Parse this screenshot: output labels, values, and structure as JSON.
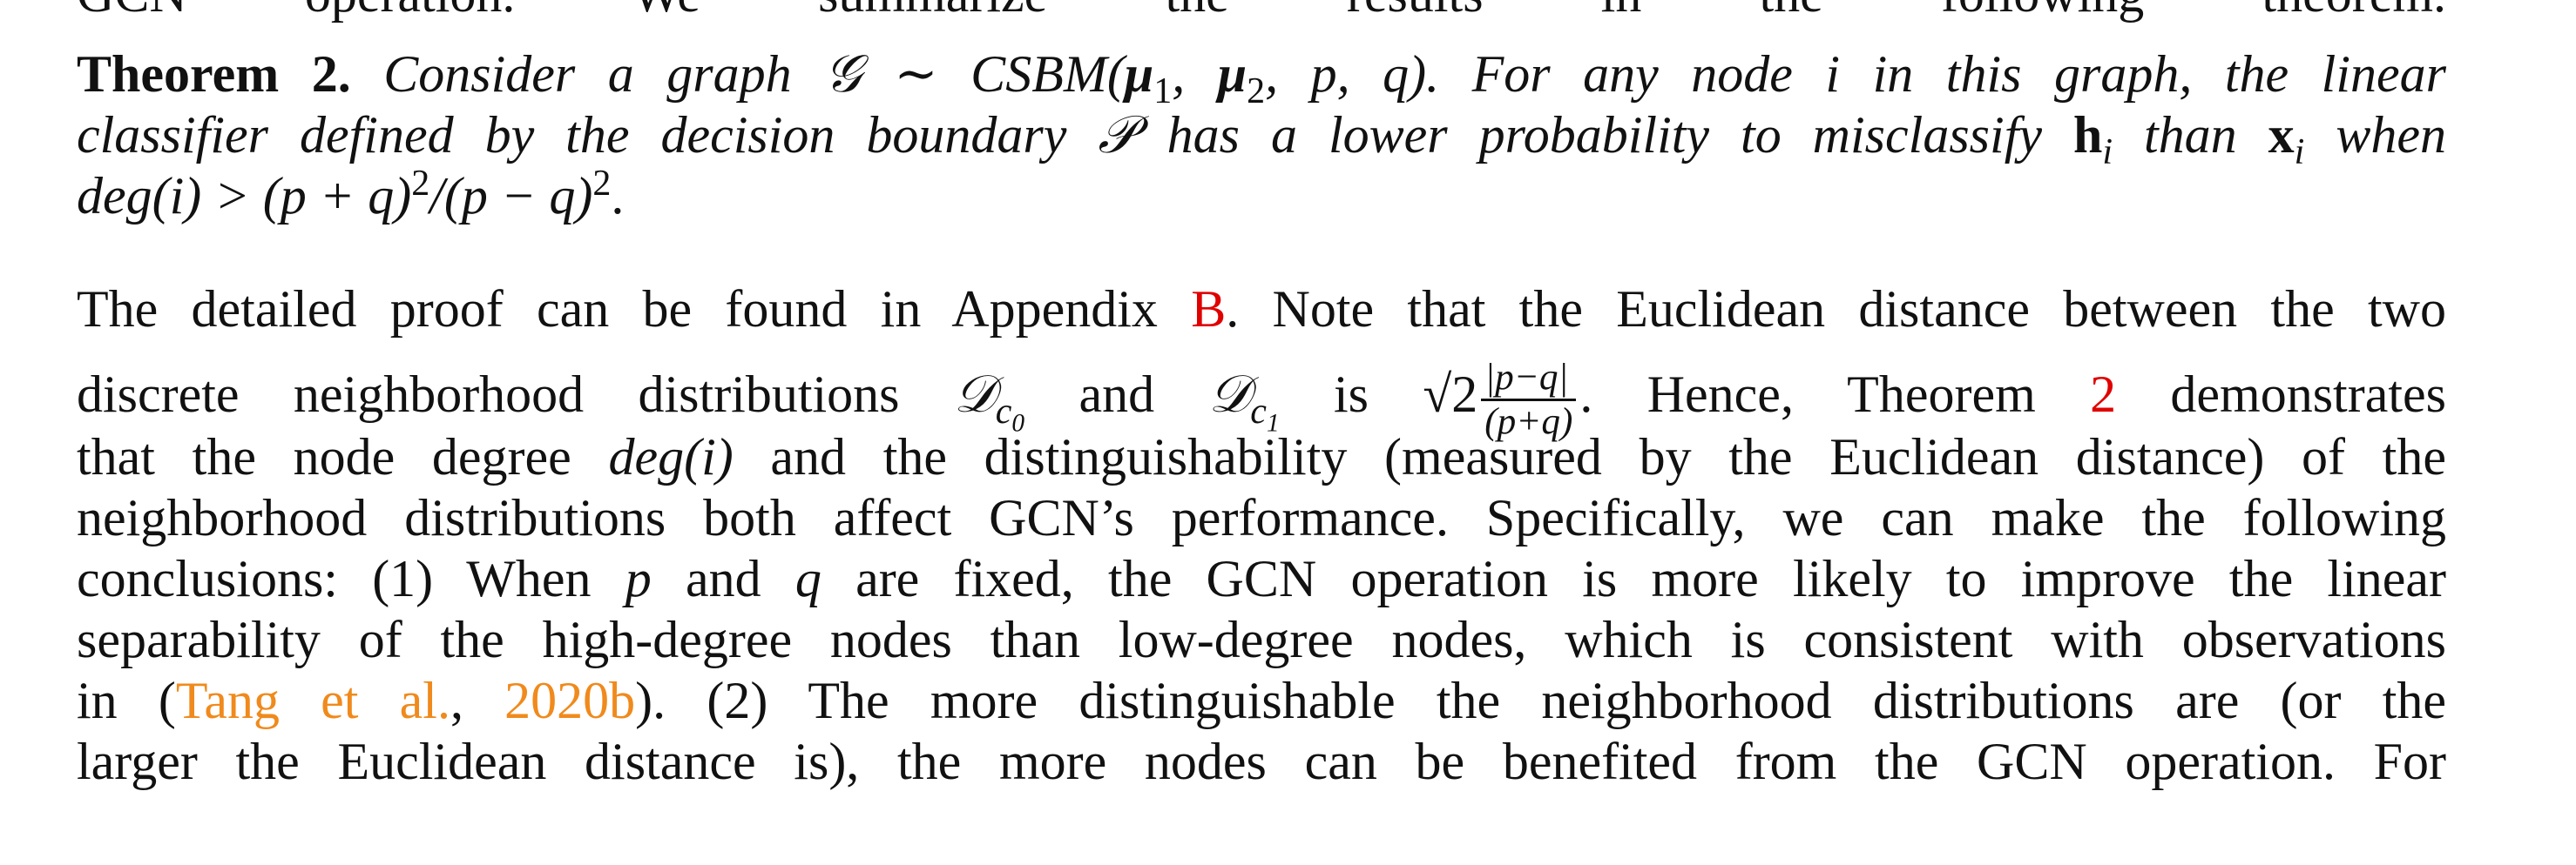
{
  "top_cut_line": "GCN operation. We summarize the results in the following theorem.",
  "theorem": {
    "label": "Theorem 2.",
    "line1": {
      "t1": "Consider a graph ",
      "graph": "𝒢",
      "t2": " ∼ CSBM(",
      "mu1": "μ",
      "mu1_sub": "1",
      "sep1": ", ",
      "mu2": "μ",
      "mu2_sub": "2",
      "t3": ", p, q). For any node i in this graph, the linear"
    },
    "line2": {
      "t1": "classifier defined by the decision boundary ",
      "boundary": "𝒫",
      "t2": " has a lower probability to misclassify ",
      "h": "h",
      "h_sub": "i",
      "t3": " than ",
      "x": "x",
      "x_sub": "i",
      "t4": " when"
    },
    "line3": {
      "t1": "deg(i) > (p + q)",
      "sup1": "2",
      "t2": "/(p − q)",
      "sup2": "2",
      "t3": "."
    }
  },
  "paragraph": {
    "l1": {
      "t1": "The detailed proof can be found in Appendix ",
      "ref": "B",
      "t2": ". Note that the Euclidean distance between the two"
    },
    "l2": {
      "t1": "discrete neighborhood distributions ",
      "d0": "𝒟",
      "d0_sub": "c",
      "d0_subsub": "0",
      "and": " and ",
      "d1": "𝒟",
      "d1_sub": "c",
      "d1_subsub": "1",
      "is": " is ",
      "sqrt": "√2",
      "frac_num": "|p−q|",
      "frac_den": "(p+q)",
      "t2": ". Hence, Theorem ",
      "ref": "2",
      "t3": " demonstrates"
    },
    "l3": {
      "t1": "that the node degree ",
      "deg": "deg(i)",
      "t2": " and the distinguishability (measured by the Euclidean distance) of the"
    },
    "l4": "neighborhood distributions both affect GCN’s performance. Specifically, we can make the following",
    "l5": {
      "t1": "conclusions: (1) When ",
      "p": "p",
      "t2": " and ",
      "q": "q",
      "t3": " are fixed, the GCN operation is more likely to improve the linear"
    },
    "l6": "separability of the high-degree nodes than low-degree nodes, which is consistent with observations",
    "l7": {
      "t1": "in (",
      "cite_a": "Tang et al.",
      "comma": ", ",
      "cite_b": "2020b",
      "t2": "). (2) The more distinguishable the neighborhood distributions are (or the"
    },
    "l8": "larger the Euclidean distance is), the more nodes can be benefited from the GCN operation. For"
  },
  "colors": {
    "text": "#111111",
    "ref_red": "#e00000",
    "cite_orange": "#f08a1c"
  }
}
